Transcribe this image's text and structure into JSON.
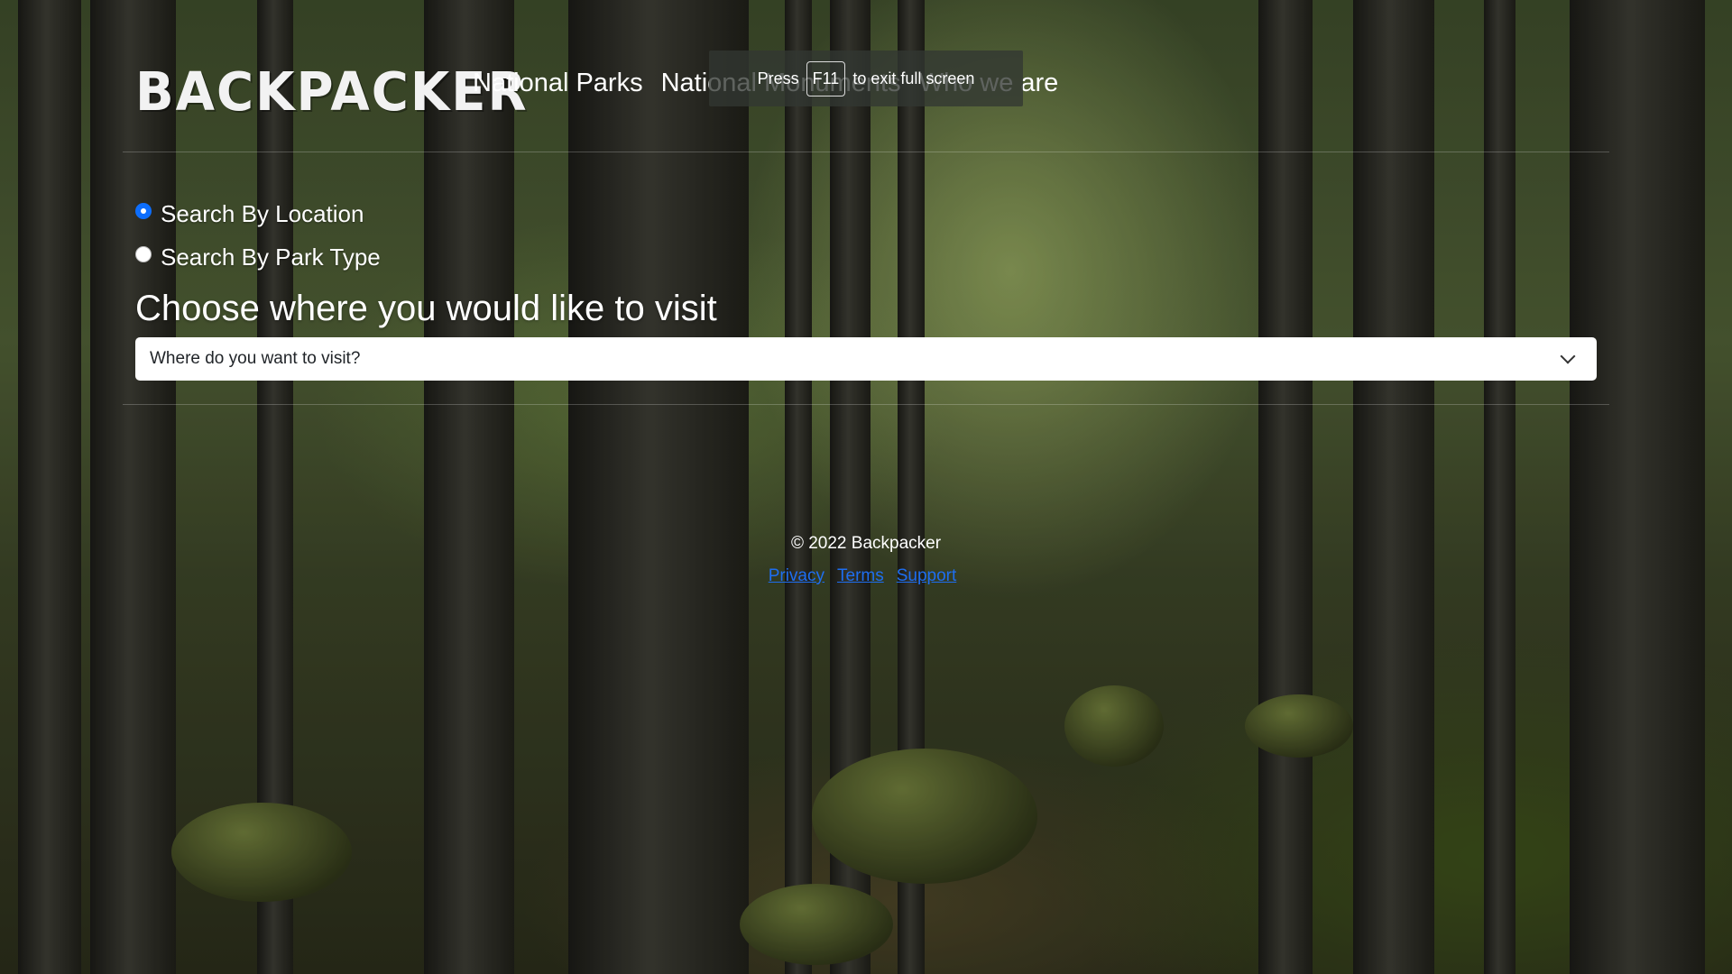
{
  "header": {
    "logo": "BACKPACKER",
    "nav": [
      "National Parks",
      "National Monuments",
      "Who we are"
    ]
  },
  "fullscreen_notice": {
    "prefix": "Press",
    "key": "F11",
    "suffix": "to exit full screen"
  },
  "search": {
    "options": [
      {
        "label": "Search By Location",
        "checked": true
      },
      {
        "label": "Search By Park Type",
        "checked": false
      }
    ],
    "heading": "Choose where you would like to visit",
    "select_value": "Where do you want to visit?"
  },
  "footer": {
    "copyright": "© 2022 Backpacker",
    "links": [
      "Privacy",
      "Terms",
      "Support"
    ]
  },
  "colors": {
    "radio_accent": "#0d6efd",
    "link": "#1e6ef0"
  }
}
